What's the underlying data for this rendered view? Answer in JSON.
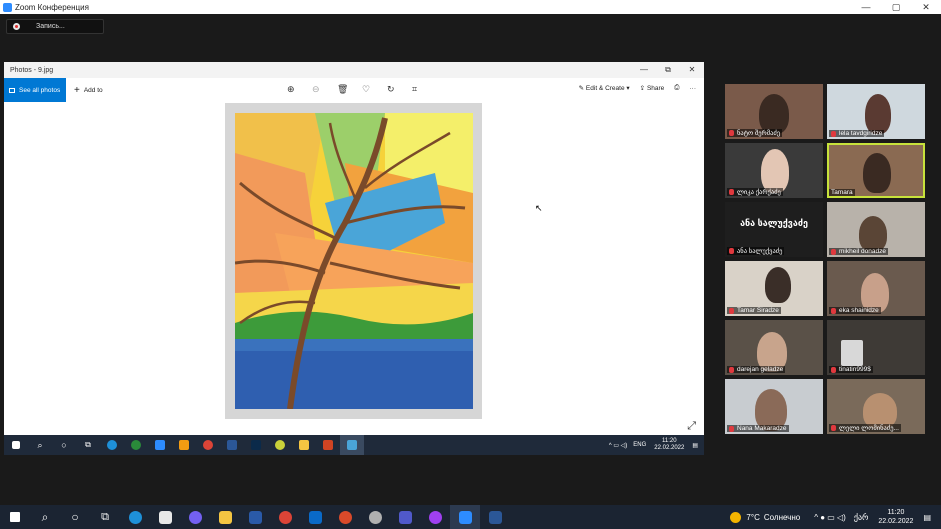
{
  "zoom": {
    "window_title": "Zoom Конференция",
    "recording_label": "Запись...",
    "window_controls": [
      "—",
      "▢",
      "✕"
    ]
  },
  "photos": {
    "window_title": "Photos - 9.jpg",
    "see_all_label": "See all photos",
    "add_to_label": "Add to",
    "edit_create_label": "Edit & Create",
    "share_label": "Share",
    "more_label": "···",
    "window_controls": [
      "—",
      "⧉",
      "✕"
    ]
  },
  "inner_taskbar": {
    "language": "ENG",
    "time": "11:20",
    "date": "22.02.2022"
  },
  "participants": [
    {
      "name": "ნატო შერმაძე"
    },
    {
      "name": "lela tavdgiridze"
    },
    {
      "name": "ლიკა ქარქაძე"
    },
    {
      "name": "Tamara"
    },
    {
      "name": "ანა სალუქვაძე",
      "video_label": "ანა სალუქვაძე"
    },
    {
      "name": "mikheil donadze"
    },
    {
      "name": "Tamar Siradze"
    },
    {
      "name": "eka shainidze"
    },
    {
      "name": "darejan geladze"
    },
    {
      "name": "tinatin999$"
    },
    {
      "name": "Nana Makaradze"
    },
    {
      "name": "ლელი ლომინაძე..."
    }
  ],
  "win_taskbar": {
    "weather_temp": "7°C",
    "weather_text": "Солнечно",
    "language": "ქარ",
    "time": "11:20",
    "date": "22.02.2022"
  },
  "colors": {
    "zoom_blue": "#2d8cff",
    "photos_accent": "#0078d4",
    "active_speaker": "#c7e23b",
    "mic_muted": "#e0393e"
  }
}
